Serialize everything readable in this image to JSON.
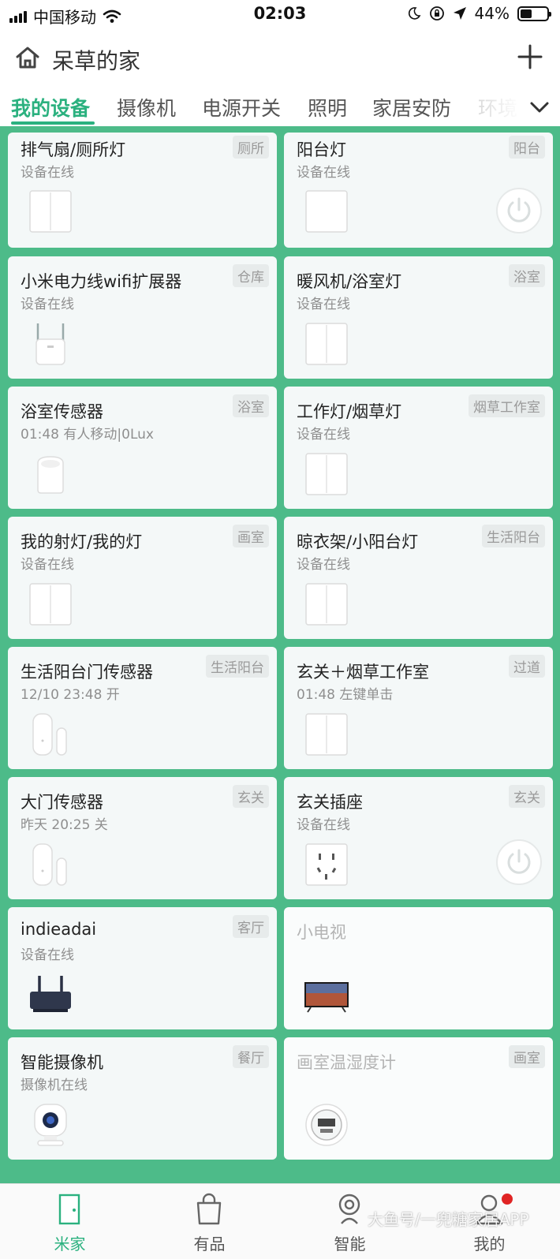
{
  "status_bar": {
    "carrier": "中国移动",
    "time": "02:03",
    "battery": "44%"
  },
  "header": {
    "home_name": "呆草的家"
  },
  "tabs": [
    "我的设备",
    "摄像机",
    "电源开关",
    "照明",
    "家居安防",
    "环境"
  ],
  "devices": [
    {
      "name": "排气扇/厕所灯",
      "status": "设备在线",
      "room": "厕所",
      "icon": "double-switch-icon",
      "power": false
    },
    {
      "name": "阳台灯",
      "status": "设备在线",
      "room": "阳台",
      "icon": "single-switch-icon",
      "power": true
    },
    {
      "name": "小米电力线wifi扩展器",
      "status": "设备在线",
      "room": "仓库",
      "icon": "wifi-extender-icon",
      "power": false
    },
    {
      "name": "暖风机/浴室灯",
      "status": "设备在线",
      "room": "浴室",
      "icon": "double-switch-icon",
      "power": false
    },
    {
      "name": "浴室传感器",
      "status": "01:48 有人移动|0Lux",
      "room": "浴室",
      "icon": "motion-sensor-icon",
      "power": false
    },
    {
      "name": "工作灯/烟草灯",
      "status": "设备在线",
      "room": "烟草工作室",
      "icon": "double-switch-icon",
      "power": false
    },
    {
      "name": "我的射灯/我的灯",
      "status": "设备在线",
      "room": "画室",
      "icon": "double-switch-icon",
      "power": false
    },
    {
      "name": "晾衣架/小阳台灯",
      "status": "设备在线",
      "room": "生活阳台",
      "icon": "double-switch-icon",
      "power": false
    },
    {
      "name": "生活阳台门传感器",
      "status": "12/10 23:48 开",
      "room": "生活阳台",
      "icon": "door-sensor-icon",
      "power": false
    },
    {
      "name": "玄关＋烟草工作室",
      "status": "01:48 左键单击",
      "room": "过道",
      "icon": "double-switch-icon",
      "power": false
    },
    {
      "name": "大门传感器",
      "status": "昨天 20:25 关",
      "room": "玄关",
      "icon": "door-sensor-icon",
      "power": false
    },
    {
      "name": "玄关插座",
      "status": "设备在线",
      "room": "玄关",
      "icon": "wall-socket-icon",
      "power": true
    },
    {
      "name": "indieadai",
      "status": "设备在线",
      "room": "客厅",
      "icon": "router-icon",
      "power": false
    },
    {
      "name": "小电视",
      "status": "",
      "room": "",
      "icon": "tv-icon",
      "power": false,
      "offline": true
    },
    {
      "name": "智能摄像机",
      "status": "摄像机在线",
      "room": "餐厅",
      "icon": "camera-icon",
      "power": false
    },
    {
      "name": "画室温湿度计",
      "status": "",
      "room": "画室",
      "icon": "thermometer-icon",
      "power": false,
      "offline": true
    }
  ],
  "bottom_nav": [
    {
      "label": "米家",
      "icon": "door-icon",
      "active": true
    },
    {
      "label": "有品",
      "icon": "bag-icon",
      "active": false
    },
    {
      "label": "智能",
      "icon": "robot-icon",
      "active": false
    },
    {
      "label": "我的",
      "icon": "profile-icon",
      "active": false,
      "dot": true
    }
  ],
  "watermark": "大鱼号/一兜糖家居APP",
  "colors": {
    "accent": "#2bb17f",
    "grid_background": "#4dbb89",
    "card": "#f4f8f8"
  }
}
